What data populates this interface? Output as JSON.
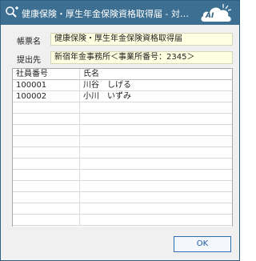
{
  "window": {
    "title": "健康保険・厚生年金保険資格取得届 - 対象者…",
    "badge": "AI"
  },
  "form": {
    "report_label": "帳票名",
    "report_value": "健康保険・厚生年金保険資格取得届",
    "dest_label": "提出先",
    "dest_value": "新宿年金事務所＜事業所番号：2345＞"
  },
  "table": {
    "columns": [
      "社員番号",
      "氏名"
    ],
    "rows": [
      [
        "100001",
        "川谷　しげる"
      ],
      [
        "100002",
        "小川　いずみ"
      ]
    ]
  },
  "footer": {
    "ok_label": "OK"
  }
}
